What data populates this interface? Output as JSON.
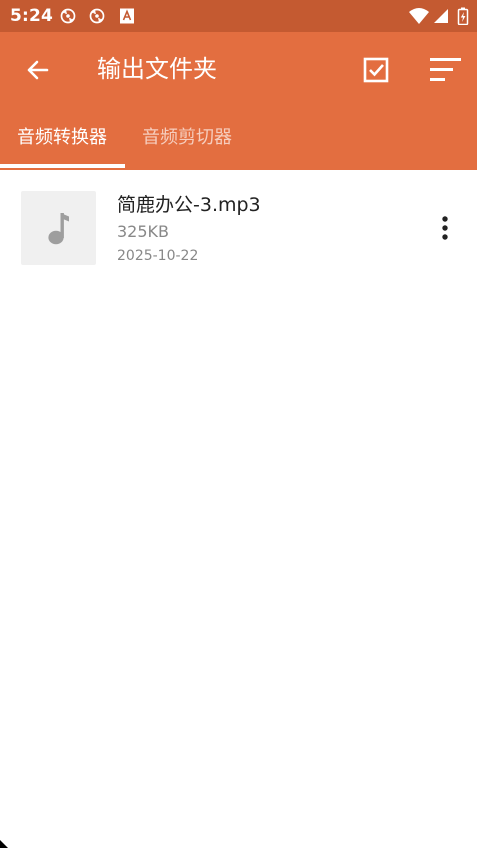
{
  "status_bar": {
    "time": "5:24",
    "icons": [
      "sync-icon",
      "sync-icon",
      "text-a-icon",
      "wifi-icon",
      "signal-icon",
      "battery-icon"
    ]
  },
  "app_bar": {
    "title": "输出文件夹",
    "back_icon": "arrow-left-icon",
    "select_icon": "checkbox-icon",
    "sort_icon": "sort-icon",
    "color": "#e36e40",
    "status_color": "#c45a31"
  },
  "tabs": [
    {
      "label": "音频转换器",
      "selected": true
    },
    {
      "label": "音频剪切器",
      "selected": false
    }
  ],
  "files": [
    {
      "name": "简鹿办公-3.mp3",
      "size": "325KB",
      "date": "2025-10-22",
      "icon": "music-note-icon",
      "menu_icon": "more-vert-icon"
    }
  ]
}
